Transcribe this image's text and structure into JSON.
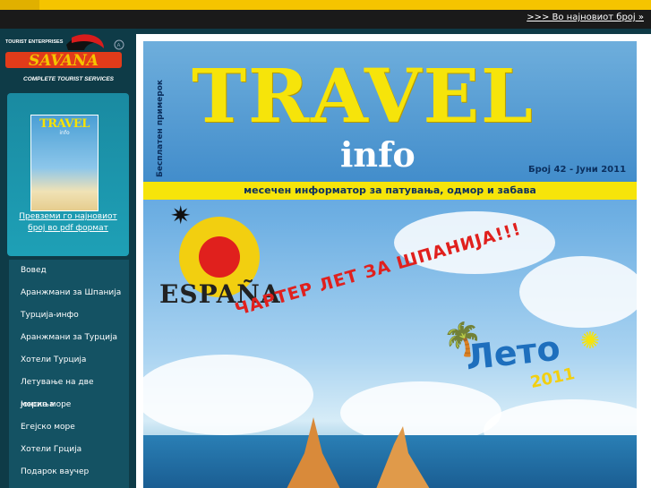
{
  "nav": {
    "latest_issue_link": ">>> Во најновиот број »"
  },
  "sidebar": {
    "logo": {
      "small_text": "TOURIST ENTERPRISES",
      "brand": "SAVANA",
      "tagline": "COMPLETE TOURIST SERVICES",
      "badge": "A"
    },
    "promo": {
      "cover_title": "TRAVEL",
      "cover_sub": "info",
      "link_text": "Превземи го најновиот број во pdf формат"
    },
    "menu": [
      {
        "label": "Вовед"
      },
      {
        "label": "Аранжмани за Шпанија"
      },
      {
        "label": "Турција-инфо"
      },
      {
        "label": "Аранжмани за Турција"
      },
      {
        "label": "Хотели Турција"
      },
      {
        "label": "Летување на две мориња"
      },
      {
        "label": "Јонско море"
      },
      {
        "label": "Егејско море"
      },
      {
        "label": "Хотели Грција"
      },
      {
        "label": "Подарок ваучер"
      }
    ]
  },
  "magazine": {
    "title": "TRAVEL",
    "subtitle": "info",
    "vertical_text": "Бесплатен примерок",
    "issue": "Број 42 - Јуни 2011",
    "tagline": "месечен информатор за патувања, одмор и забава",
    "espana_text": "ESPAÑA",
    "charter_banner": "ЧАРТЕР ЛЕТ ЗА ШПАНИЈА!!!",
    "leto_text": "Лето",
    "leto_year": "2011"
  },
  "colors": {
    "accent_yellow": "#f5c400",
    "sidebar_bg": "#0e3b47",
    "menu_bg": "#145263",
    "banner_red": "#e0201d"
  }
}
